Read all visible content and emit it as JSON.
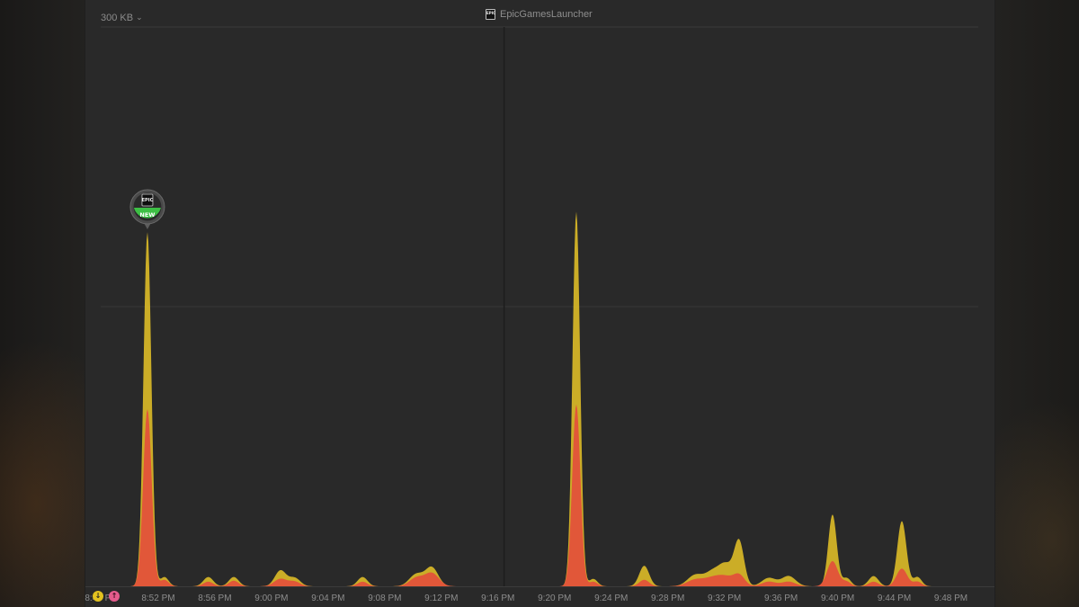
{
  "header": {
    "scale_label": "300 KB",
    "app_name": "EpicGamesLauncher",
    "app_icon_text": "EPIC"
  },
  "marker": {
    "icon_text": "EPIC",
    "badge": "NEW"
  },
  "legend": {
    "download_icon": "arrow-down-icon",
    "upload_icon": "arrow-up-icon",
    "download_color": "#e3c21f",
    "upload_color": "#e55b8c"
  },
  "chart_data": {
    "type": "area",
    "ylim": [
      0,
      600
    ],
    "y_gridlines": [
      300
    ],
    "x_ticks": [
      "8:48 PM",
      "8:52 PM",
      "8:56 PM",
      "9:00 PM",
      "9:04 PM",
      "9:08 PM",
      "9:12 PM",
      "9:16 PM",
      "9:20 PM",
      "9:24 PM",
      "9:28 PM",
      "9:32 PM",
      "9:36 PM",
      "9:40 PM",
      "9:44 PM",
      "9:48 PM"
    ],
    "x_start_minutes": 528,
    "x_end_minutes": 590,
    "divider_minutes": 556.5,
    "series": [
      {
        "color": "#d9b927",
        "peaks": [
          {
            "t": 531.3,
            "v": 380,
            "w": 0.28
          },
          {
            "t": 532.5,
            "v": 10,
            "w": 0.3
          },
          {
            "t": 535.6,
            "v": 10,
            "w": 0.35
          },
          {
            "t": 537.4,
            "v": 10,
            "w": 0.35
          },
          {
            "t": 540.7,
            "v": 17,
            "w": 0.4
          },
          {
            "t": 541.7,
            "v": 9,
            "w": 0.4
          },
          {
            "t": 546.5,
            "v": 10,
            "w": 0.35
          },
          {
            "t": 550.3,
            "v": 13,
            "w": 0.5
          },
          {
            "t": 551.4,
            "v": 20,
            "w": 0.45
          },
          {
            "t": 561.6,
            "v": 402,
            "w": 0.27
          },
          {
            "t": 562.8,
            "v": 8,
            "w": 0.3
          },
          {
            "t": 566.4,
            "v": 22,
            "w": 0.35
          },
          {
            "t": 570.0,
            "v": 12,
            "w": 0.55
          },
          {
            "t": 571.3,
            "v": 16,
            "w": 0.55
          },
          {
            "t": 572.2,
            "v": 20,
            "w": 0.45
          },
          {
            "t": 573.1,
            "v": 48,
            "w": 0.35
          },
          {
            "t": 575.2,
            "v": 9,
            "w": 0.5
          },
          {
            "t": 576.6,
            "v": 11,
            "w": 0.5
          },
          {
            "t": 579.7,
            "v": 77,
            "w": 0.3
          },
          {
            "t": 580.7,
            "v": 9,
            "w": 0.3
          },
          {
            "t": 582.6,
            "v": 11,
            "w": 0.35
          },
          {
            "t": 584.6,
            "v": 70,
            "w": 0.32
          },
          {
            "t": 585.7,
            "v": 10,
            "w": 0.3
          }
        ]
      },
      {
        "color": "#e2523a",
        "peaks": [
          {
            "t": 531.3,
            "v": 190,
            "w": 0.3
          },
          {
            "t": 532.5,
            "v": 7,
            "w": 0.3
          },
          {
            "t": 535.6,
            "v": 5,
            "w": 0.35
          },
          {
            "t": 537.4,
            "v": 6,
            "w": 0.35
          },
          {
            "t": 540.7,
            "v": 8,
            "w": 0.45
          },
          {
            "t": 541.7,
            "v": 5,
            "w": 0.4
          },
          {
            "t": 546.5,
            "v": 5,
            "w": 0.35
          },
          {
            "t": 550.3,
            "v": 9,
            "w": 0.5
          },
          {
            "t": 551.4,
            "v": 14,
            "w": 0.5
          },
          {
            "t": 561.6,
            "v": 195,
            "w": 0.29
          },
          {
            "t": 562.8,
            "v": 5,
            "w": 0.3
          },
          {
            "t": 566.4,
            "v": 7,
            "w": 0.35
          },
          {
            "t": 570.0,
            "v": 7,
            "w": 0.6
          },
          {
            "t": 571.3,
            "v": 9,
            "w": 0.6
          },
          {
            "t": 572.2,
            "v": 8,
            "w": 0.5
          },
          {
            "t": 573.1,
            "v": 12,
            "w": 0.4
          },
          {
            "t": 575.2,
            "v": 5,
            "w": 0.5
          },
          {
            "t": 576.6,
            "v": 5,
            "w": 0.5
          },
          {
            "t": 579.7,
            "v": 27,
            "w": 0.38
          },
          {
            "t": 580.7,
            "v": 5,
            "w": 0.3
          },
          {
            "t": 582.6,
            "v": 5,
            "w": 0.35
          },
          {
            "t": 584.6,
            "v": 19,
            "w": 0.38
          },
          {
            "t": 585.7,
            "v": 5,
            "w": 0.3
          }
        ]
      }
    ]
  }
}
